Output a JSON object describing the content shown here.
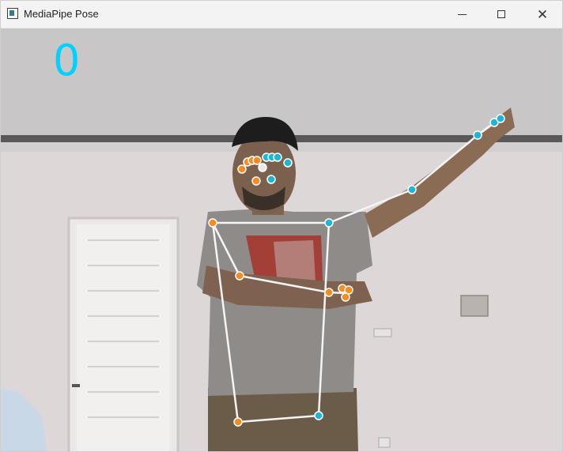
{
  "window": {
    "title": "MediaPipe Pose",
    "app_icon": "window-icon",
    "controls": {
      "minimize_icon": "minimize-icon",
      "maximize_icon": "maximize-icon",
      "close_icon": "close-icon",
      "close_glyph": "✕"
    }
  },
  "overlay": {
    "counter_text": "0",
    "counter_color": "#00d2ff",
    "left_side_landmark_color": "#ff8a1e",
    "right_side_landmark_color": "#1ab8d6",
    "connection_color": "#f5f5f5"
  }
}
